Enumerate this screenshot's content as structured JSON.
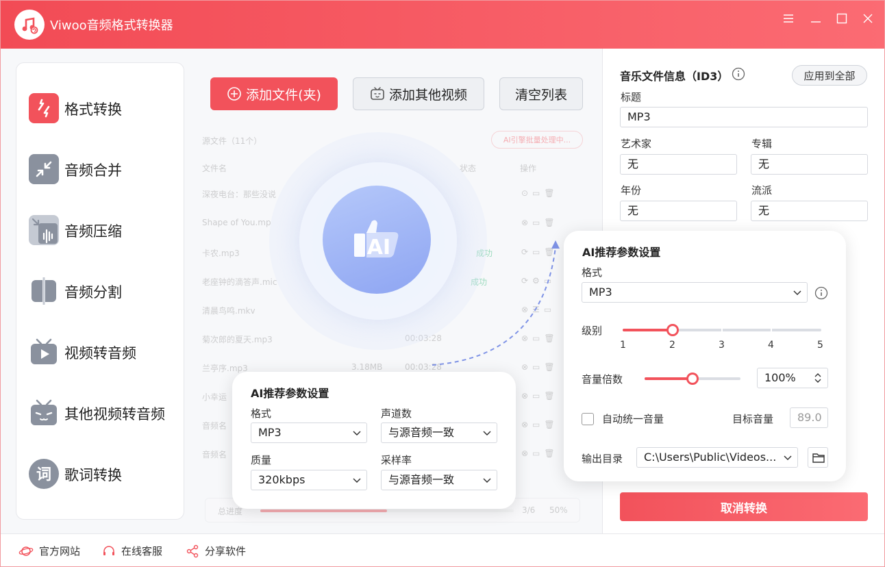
{
  "app": {
    "title": "Viwoo音频格式转换器"
  },
  "sidebar": {
    "items": [
      {
        "label": "格式转换",
        "icon": "format-convert-icon"
      },
      {
        "label": "音频合并",
        "icon": "merge-icon"
      },
      {
        "label": "音频压缩",
        "icon": "compress-icon"
      },
      {
        "label": "音频分割",
        "icon": "split-icon"
      },
      {
        "label": "视频转音频",
        "icon": "video-to-audio-icon"
      },
      {
        "label": "其他视频转音频",
        "icon": "other-video-icon"
      },
      {
        "label": "歌词转换",
        "icon": "lyrics-icon"
      }
    ]
  },
  "toolbar": {
    "add_files": "添加文件(夹)",
    "add_other_video": "添加其他视频",
    "clear_list": "清空列表"
  },
  "file_list": {
    "source_label": "源文件（11个）",
    "ai_badge": "AI引擎批量处理中...",
    "col_name": "文件名",
    "col_status": "状态",
    "col_actions": "操作",
    "rows": [
      {
        "name": "深夜电台：那些没说",
        "size": "",
        "duration": "",
        "status": ""
      },
      {
        "name": "Shape of You.mp",
        "size": "",
        "duration": "",
        "status": ""
      },
      {
        "name": "卡农.mp3",
        "size": "",
        "duration": "",
        "status": "成功"
      },
      {
        "name": "老座钟的滴答声.mic",
        "size": "",
        "duration": "",
        "status": "成功"
      },
      {
        "name": "清晨鸟鸣.mkv",
        "size": "",
        "duration": "",
        "status": ""
      },
      {
        "name": "菊次郎的夏天.mp3",
        "size": "",
        "duration": "00:03:28",
        "status": ""
      },
      {
        "name": "兰亭序.mp3",
        "size": "3.18MB",
        "duration": "00:03:28",
        "status": ""
      },
      {
        "name": "小幸运",
        "size": "",
        "duration": "",
        "status": ""
      },
      {
        "name": "音频名",
        "size": "",
        "duration": "",
        "status": ""
      },
      {
        "name": "音频名",
        "size": "",
        "duration": "",
        "status": ""
      }
    ],
    "progress_label": "总进度",
    "progress_count": "3/6",
    "progress_percent": "50%",
    "progress_value": 0.5
  },
  "ai_center": {
    "label": "AI"
  },
  "popup_bottom": {
    "title": "AI推荐参数设置",
    "format_label": "格式",
    "format_value": "MP3",
    "channels_label": "声道数",
    "channels_value": "与源音频一致",
    "quality_label": "质量",
    "quality_value": "320kbps",
    "samplerate_label": "采样率",
    "samplerate_value": "与源音频一致"
  },
  "popup_right": {
    "title": "AI推荐参数设置",
    "format_label": "格式",
    "format_value": "MP3",
    "level_label": "级别",
    "level_ticks": [
      "1",
      "2",
      "3",
      "4",
      "5"
    ],
    "level_value": 2,
    "volume_label": "音量倍数",
    "volume_value": "100%",
    "volume_fraction": 0.5,
    "auto_volume_label": "自动统一音量",
    "auto_volume_checked": false,
    "target_volume_label": "目标音量",
    "target_volume_value": "89.0",
    "output_label": "输出目录",
    "output_value": "C:\\Users\\Public\\Videos..."
  },
  "id3": {
    "title": "音乐文件信息（ID3）",
    "apply_all": "应用到全部",
    "title_label": "标题",
    "title_value": "MP3",
    "artist_label": "艺术家",
    "artist_value": "无",
    "album_label": "专辑",
    "album_value": "无",
    "year_label": "年份",
    "year_value": "无",
    "genre_label": "流派",
    "genre_value": "无"
  },
  "cancel_button": "取消转换",
  "footer": {
    "website": "官方网站",
    "support": "在线客服",
    "share": "分享软件"
  },
  "colors": {
    "accent": "#f2525b",
    "ai_blue": "#8ea5f2",
    "success": "#2bb673"
  }
}
